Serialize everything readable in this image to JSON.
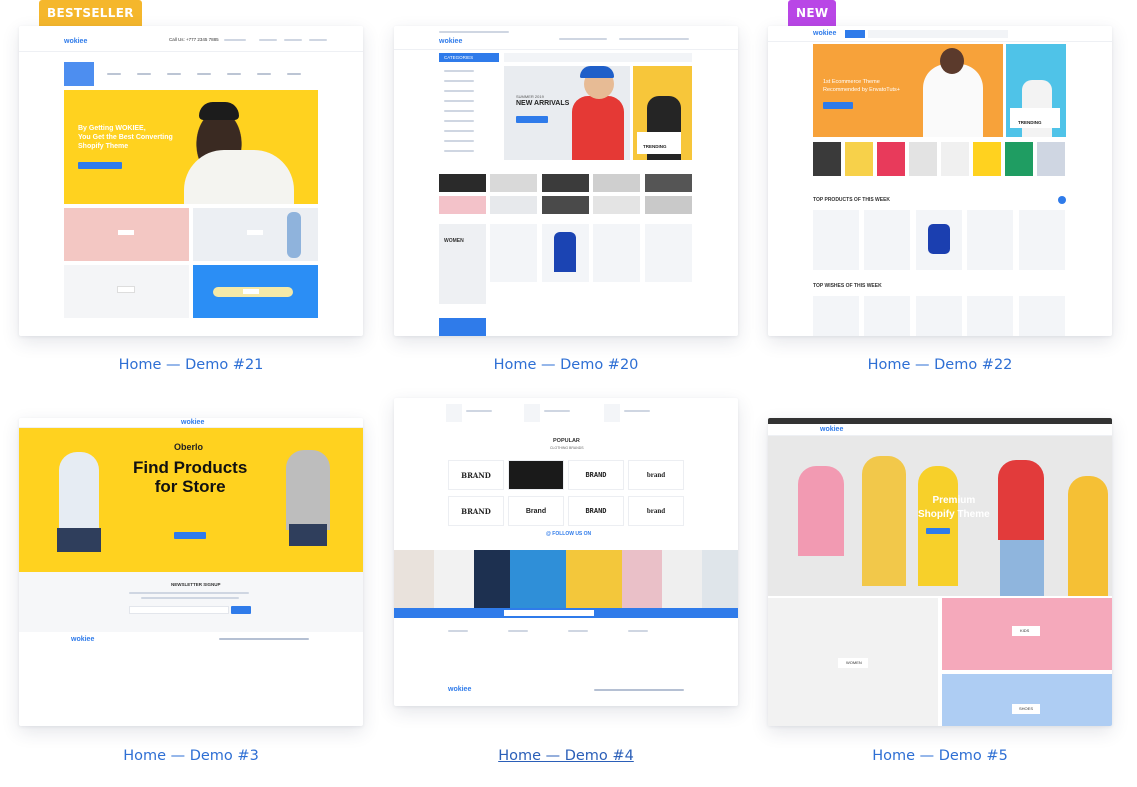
{
  "cards": [
    {
      "caption": "Home — Demo #21",
      "badge": "BESTSELLER",
      "hero": "By Getting WOKIEE,\nYou Get the Best Converting\nShopify Theme",
      "logo": "wokiee",
      "phone": "Call Us: +777 2345 7885"
    },
    {
      "caption": "Home — Demo #20",
      "badge": "",
      "hero_small": "SUMMER 2019",
      "hero": "NEW ARRIVALS",
      "side": "TRENDING",
      "logo": "wokiee",
      "category": "CATEGORIES",
      "women": "WOMEN"
    },
    {
      "caption": "Home — Demo #22",
      "badge": "NEW",
      "hero": "1st Ecommerce Theme\nRecommended by EnvatoTuts+",
      "side": "TRENDING",
      "section1": "TOP PRODUCTS OF THIS WEEK",
      "section2": "TOP WISHES OF THIS WEEK",
      "logo": "wokiee"
    },
    {
      "caption": "Home — Demo #3",
      "badge": "",
      "hero_small": "Oberlo",
      "hero": "Find Products\nfor Store",
      "newsletter": "NEWSLETTER SIGNUP",
      "logo": "wokiee"
    },
    {
      "caption": "Home — Demo #4",
      "badge": "",
      "popular": "POPULAR",
      "popular_sub": "CLOTHING BRANDS",
      "follow": "@ FOLLOW US ON",
      "brands": [
        "BRAND",
        "",
        "BRAND",
        "brand",
        "BRAND",
        "Brand",
        "BRAND",
        "brand"
      ],
      "logo": "wokiee"
    },
    {
      "caption": "Home — Demo #5",
      "badge": "",
      "hero": "Premium\nShopify Theme",
      "logo": "wokiee",
      "tag1": "WOMEN",
      "tag2": "KIDS",
      "tag3": "SHOES"
    }
  ],
  "colors": {
    "accent": "#2e6fd4",
    "yellow": "#ffd21f",
    "orange": "#f7a23a",
    "bestseller": "#f5b72c",
    "new": "#b946e6"
  }
}
